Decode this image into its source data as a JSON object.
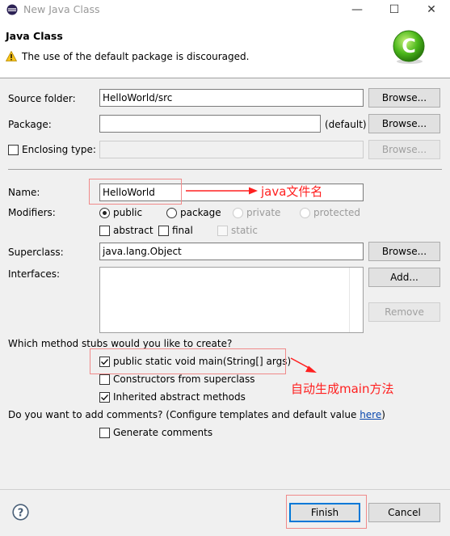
{
  "window": {
    "title": "New Java Class",
    "minimize_glyph": "—",
    "maximize_glyph": "☐",
    "close_glyph": "✕"
  },
  "header": {
    "title": "Java Class",
    "warning": "The use of the default package is discouraged.",
    "logo_letter": "C"
  },
  "form": {
    "source_folder": {
      "label": "Source folder:",
      "value": "HelloWorld/src",
      "button": "Browse..."
    },
    "package": {
      "label": "Package:",
      "value": "",
      "suffix": "(default)",
      "button": "Browse..."
    },
    "enclosing_type": {
      "label": "Enclosing type:",
      "value": "",
      "button": "Browse...",
      "checked": false
    },
    "name": {
      "label": "Name:",
      "value": "HelloWorld"
    },
    "modifiers": {
      "label": "Modifiers:",
      "radios": [
        "public",
        "package",
        "private",
        "protected"
      ],
      "selected": "public",
      "checks": [
        "abstract",
        "final",
        "static"
      ]
    },
    "superclass": {
      "label": "Superclass:",
      "value": "java.lang.Object",
      "button": "Browse..."
    },
    "interfaces": {
      "label": "Interfaces:",
      "add_button": "Add...",
      "remove_button": "Remove"
    },
    "stubs": {
      "question": "Which method stubs would you like to create?",
      "options": [
        {
          "label": "public static void main(String[] args)",
          "checked": true
        },
        {
          "label": "Constructors from superclass",
          "checked": false
        },
        {
          "label": "Inherited abstract methods",
          "checked": true
        }
      ]
    },
    "comments": {
      "question": "Do you want to add comments? (Configure templates and default value ",
      "link": "here",
      "question_end": ")",
      "option": {
        "label": "Generate comments",
        "checked": false
      }
    }
  },
  "annotations": {
    "name_note": "java文件名",
    "main_note": "自动生成main方法",
    "color": "#ff2020"
  },
  "footer": {
    "help_glyph": "?",
    "finish": "Finish",
    "cancel": "Cancel"
  }
}
